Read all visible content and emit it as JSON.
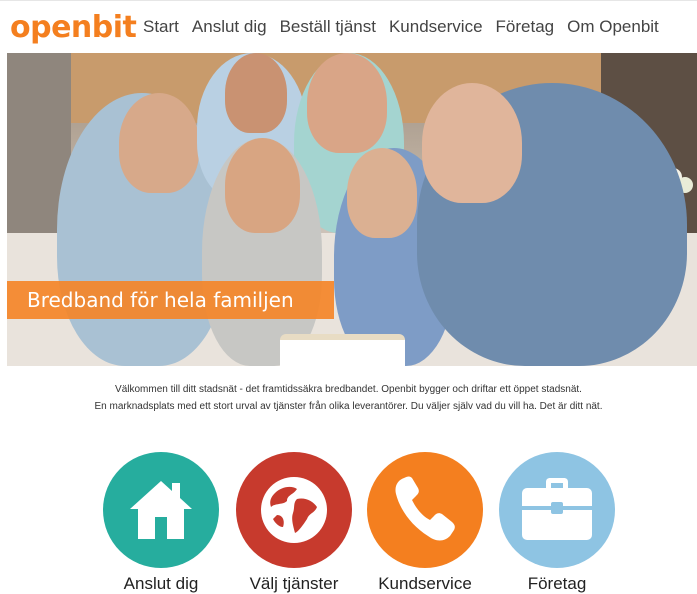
{
  "header": {
    "logo": "openbit",
    "nav": [
      "Start",
      "Anslut dig",
      "Beställ tjänst",
      "Kundservice",
      "Företag",
      "Om Openbit"
    ]
  },
  "hero": {
    "banner": "Bredband för hela familjen"
  },
  "intro": {
    "line1": "Välkommen till ditt stadsnät - det framtidssäkra bredbandet. Openbit bygger och driftar ett öppet stadsnät.",
    "line2": "En marknadsplats med ett stort urval av tjänster från olika leverantörer. Du väljer själv vad du vill ha. Det är ditt nät."
  },
  "tiles": [
    {
      "label": "Anslut dig",
      "icon": "house-icon",
      "color": "#26ad9e"
    },
    {
      "label": "Välj tjänster",
      "icon": "globe-icon",
      "color": "#c73a2d"
    },
    {
      "label": "Kundservice",
      "icon": "phone-icon",
      "color": "#f47f1f"
    },
    {
      "label": "Företag",
      "icon": "briefcase-icon",
      "color": "#8ec4e3"
    }
  ],
  "colors": {
    "brand": "#f47f1f",
    "banner": "#f48528"
  }
}
